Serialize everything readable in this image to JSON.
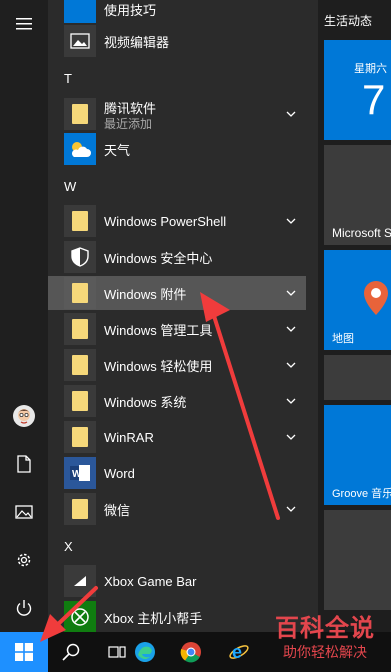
{
  "app_list": {
    "partial_top": {
      "label": "使用技巧"
    },
    "video_editor": {
      "label": "视频编辑器"
    },
    "section_t": "T",
    "tencent": {
      "label": "腾讯软件",
      "sub": "最近添加"
    },
    "weather": {
      "label": "天气"
    },
    "section_w": "W",
    "powershell": {
      "label": "Windows PowerShell"
    },
    "security": {
      "label": "Windows 安全中心"
    },
    "accessories": {
      "label": "Windows 附件"
    },
    "admin_tools": {
      "label": "Windows 管理工具"
    },
    "ease_access": {
      "label": "Windows 轻松使用"
    },
    "system": {
      "label": "Windows 系统"
    },
    "winrar": {
      "label": "WinRAR"
    },
    "word": {
      "label": "Word"
    },
    "wechat": {
      "label": "微信"
    },
    "section_x": "X",
    "xbox_gamebar": {
      "label": "Xbox Game Bar"
    },
    "xbox_companion": {
      "label": "Xbox 主机小帮手"
    }
  },
  "tiles": {
    "header": "生活动态",
    "calendar": {
      "day": "星期六",
      "date": "7"
    },
    "store": {
      "label": "Microsoft S"
    },
    "maps": {
      "label": "地图"
    },
    "groove": {
      "label": "Groove 音乐"
    }
  },
  "watermark": {
    "main": "百科全说",
    "sub": "助你轻松解决"
  },
  "colors": {
    "folder": "#f6d87a",
    "tile_blue": "#0078d7",
    "arrow_red": "#f03c3c",
    "selected_row": "#565656"
  },
  "icons": {
    "menu": "hamburger-icon",
    "user": "avatar",
    "documents": "document-icon",
    "pictures": "pictures-icon",
    "settings": "gear-icon",
    "power": "power-icon",
    "start": "windows-logo-icon",
    "search": "search-icon"
  }
}
